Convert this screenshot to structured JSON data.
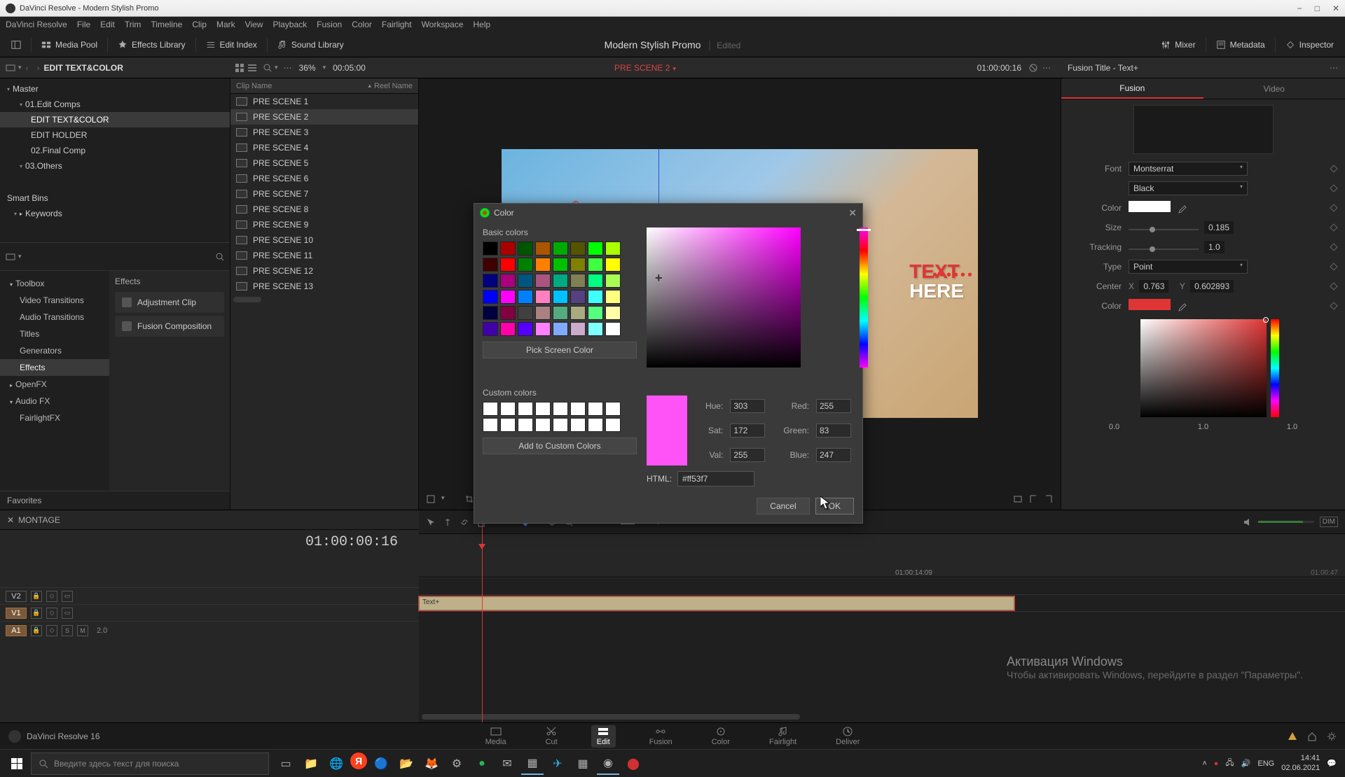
{
  "app": {
    "title": "DaVinci Resolve - Modern Stylish Promo"
  },
  "menubar": [
    "DaVinci Resolve",
    "File",
    "Edit",
    "Trim",
    "Timeline",
    "Clip",
    "Mark",
    "View",
    "Playback",
    "Fusion",
    "Color",
    "Fairlight",
    "Workspace",
    "Help"
  ],
  "toolbar": {
    "media_pool": "Media Pool",
    "effects_lib": "Effects Library",
    "edit_index": "Edit Index",
    "sound_lib": "Sound Library",
    "mixer": "Mixer",
    "metadata": "Metadata",
    "inspector": "Inspector",
    "project_title": "Modern Stylish Promo",
    "edited": "Edited"
  },
  "secondbar": {
    "bin_path": "EDIT TEXT&COLOR",
    "zoom": "36%",
    "tc": "00:05:00",
    "scene": "PRE SCENE 2",
    "tc_right": "01:00:00:16",
    "inspector_title": "Fusion Title - Text+"
  },
  "bins": {
    "master": "Master",
    "items": [
      {
        "label": "01.Edit Comps",
        "sel": false
      },
      {
        "label": "EDIT TEXT&COLOR",
        "sel": true,
        "leaf": true
      },
      {
        "label": "EDIT HOLDER",
        "sel": false,
        "leaf": true
      },
      {
        "label": "02.Final Comp",
        "sel": false,
        "leaf": true
      },
      {
        "label": "03.Others",
        "sel": false
      }
    ],
    "smart_hdr": "Smart Bins",
    "keywords": "Keywords"
  },
  "eff_panel": {
    "header": "Effects",
    "side": [
      {
        "label": "Toolbox",
        "hdr": true
      },
      {
        "label": "Video Transitions",
        "sub": true
      },
      {
        "label": "Audio Transitions",
        "sub": true
      },
      {
        "label": "Titles",
        "sub": true
      },
      {
        "label": "Generators",
        "sub": true
      },
      {
        "label": "Effects",
        "sub": true,
        "sel": true
      },
      {
        "label": "OpenFX",
        "hdr": true
      },
      {
        "label": "Audio FX",
        "hdr": true
      },
      {
        "label": "FairlightFX",
        "sub": true
      }
    ],
    "items": [
      "Adjustment Clip",
      "Fusion Composition"
    ],
    "favorites": "Favorites"
  },
  "cliplist": {
    "col1": "Clip Name",
    "col2": "Reel Name",
    "items": [
      "PRE SCENE 1",
      "PRE SCENE 2",
      "PRE SCENE 3",
      "PRE SCENE 4",
      "PRE SCENE 5",
      "PRE SCENE 6",
      "PRE SCENE 7",
      "PRE SCENE 8",
      "PRE SCENE 9",
      "PRE SCENE 10",
      "PRE SCENE 11",
      "PRE SCENE 12",
      "PRE SCENE 13"
    ],
    "selected": 1
  },
  "preview": {
    "text1": "TEXT",
    "text2": "HERE"
  },
  "inspector": {
    "tabs": [
      "Fusion",
      "Video"
    ],
    "font_lbl": "Font",
    "font_val": "Montserrat",
    "weight_val": "Black",
    "color_lbl": "Color",
    "size_lbl": "Size",
    "size_val": "0.185",
    "tracking_lbl": "Tracking",
    "tracking_val": "1.0",
    "type_lbl": "Type",
    "type_val": "Point",
    "center_lbl": "Center",
    "center_x_lbl": "X",
    "center_x": "0.763",
    "center_y_lbl": "Y",
    "center_y": "0.602893",
    "color2_lbl": "Color",
    "nums": [
      "0.0",
      "1.0",
      "1.0"
    ]
  },
  "timeline": {
    "tab": "MONTAGE",
    "tc": "01:00:00:16",
    "ruler_tick": "01:00:14:09",
    "tracks": {
      "v2": "V2",
      "v1": "V1",
      "a1": "A1",
      "a1_db": "2.0"
    },
    "clip": "Text+"
  },
  "pages": {
    "items": [
      "Media",
      "Cut",
      "Edit",
      "Fusion",
      "Color",
      "Fairlight",
      "Deliver"
    ],
    "active": 2,
    "home_label": "DaVinci Resolve 16"
  },
  "watermark": {
    "title": "Активация Windows",
    "sub": "Чтобы активировать Windows, перейдите в раздел \"Параметры\"."
  },
  "taskbar": {
    "search_placeholder": "Введите здесь текст для поиска",
    "lang": "ENG",
    "time": "14:41",
    "date": "02.06.2021"
  },
  "color_dialog": {
    "title": "Color",
    "basic_lbl": "Basic colors",
    "pick_btn": "Pick Screen Color",
    "custom_lbl": "Custom colors",
    "add_custom": "Add to Custom Colors",
    "hue_lbl": "Hue:",
    "hue": "303",
    "sat_lbl": "Sat:",
    "sat": "172",
    "val_lbl": "Val:",
    "val": "255",
    "red_lbl": "Red:",
    "red": "255",
    "green_lbl": "Green:",
    "green": "83",
    "blue_lbl": "Blue:",
    "blue": "247",
    "html_lbl": "HTML:",
    "html": "#ff53f7",
    "cancel": "Cancel",
    "ok": "OK",
    "basic_colors": [
      "#000000",
      "#aa0000",
      "#005500",
      "#aa5500",
      "#00aa00",
      "#555500",
      "#00ff00",
      "#aaff00",
      "#400000",
      "#ff0000",
      "#008000",
      "#ff8000",
      "#00c000",
      "#808000",
      "#40ff40",
      "#ffff00",
      "#000080",
      "#aa0080",
      "#005580",
      "#aa5580",
      "#00aa80",
      "#808055",
      "#00ff80",
      "#aaff55",
      "#0000ff",
      "#ff00ff",
      "#0080ff",
      "#ff80c0",
      "#00c0ff",
      "#554080",
      "#40ffff",
      "#ffff80",
      "#000040",
      "#800040",
      "#404040",
      "#aa8080",
      "#55aa80",
      "#aaaa80",
      "#55ff80",
      "#ffffaa",
      "#4000aa",
      "#ff00aa",
      "#5500ff",
      "#ff80ff",
      "#80aaff",
      "#ccaacc",
      "#80ffff",
      "#ffffff"
    ]
  }
}
